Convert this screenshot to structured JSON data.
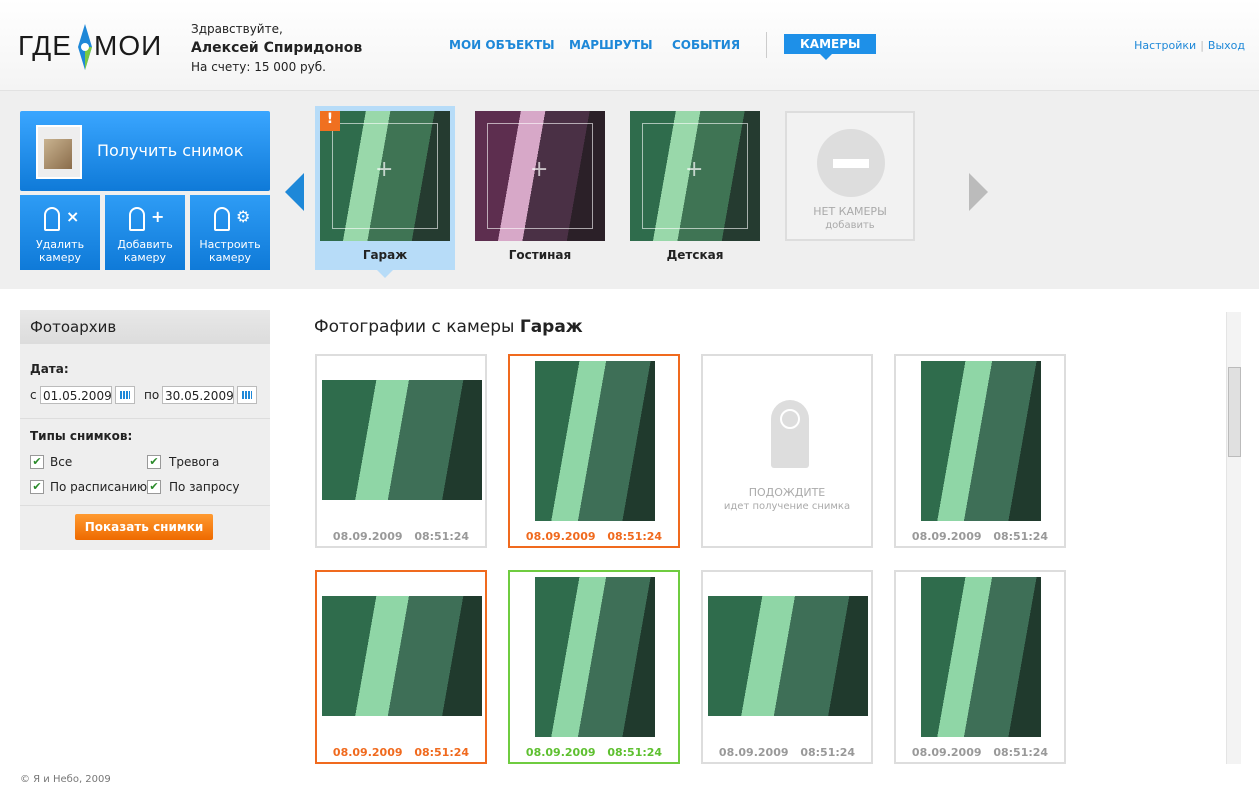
{
  "header": {
    "logo_left": "ГДЕ",
    "logo_right": "МОИ",
    "greeting": "Здравствуйте,",
    "user_name": "Алексей Спиридонов",
    "balance": "На счету: 15 000 руб.",
    "nav": [
      "МОИ ОБЪЕКТЫ",
      "МАРШРУТЫ",
      "СОБЫТИЯ"
    ],
    "nav_active": "КАМЕРЫ",
    "settings": "Настройки",
    "sep": "|",
    "logout": "Выход"
  },
  "cameras_panel": {
    "snapshot_button": "Получить снимок",
    "delete_camera": [
      "Удалить",
      "камеру"
    ],
    "add_camera": [
      "Добавить",
      "камеру"
    ],
    "configure_camera": [
      "Настроить",
      "камеру"
    ],
    "cameras": [
      "Гараж",
      "Гостиная",
      "Детская"
    ],
    "warning_mark": "!",
    "no_camera": "НЕТ КАМЕРЫ",
    "no_camera_add": "добавить"
  },
  "archive": {
    "title": "Фотоархив",
    "date_label": "Дата:",
    "from_label": "с",
    "from_value": "01.05.2009",
    "to_label": "по",
    "to_value": "30.05.2009",
    "types_label": "Типы снимков:",
    "types": [
      "Все",
      "Тревога",
      "По расписанию",
      "По запросу"
    ],
    "check_mark": "✔",
    "show_button": "Показать снимки"
  },
  "gallery": {
    "title_prefix": "Фотографии с камеры",
    "title_camera": "Гараж",
    "wait_title": "ПОДОЖДИТЕ",
    "wait_sub": "идет получение снимка",
    "photos": [
      "08.09.2009 08:51:24",
      "08.09.2009 08:51:24",
      "08.09.2009 08:51:24",
      "08.09.2009 08:51:24",
      "08.09.2009 08:51:24",
      "08.09.2009 08:51:24",
      "08.09.2009 08:51:24"
    ]
  },
  "footer": "© Я и Небо, 2009",
  "colors": {
    "accent": "#1e88d8",
    "alarm": "#f06a1e",
    "ok": "#6fcc40"
  }
}
